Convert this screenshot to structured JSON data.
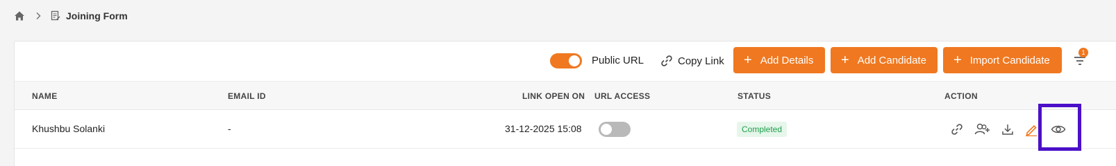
{
  "breadcrumb": {
    "home_icon": "home-icon",
    "separator_icon": "chevron-right-icon",
    "page_icon": "form-document-icon",
    "title": "Joining Form"
  },
  "toolbar": {
    "public_url_label": "Public URL",
    "public_url_enabled": true,
    "copy_link_label": "Copy Link",
    "add_details_label": "Add Details",
    "add_candidate_label": "Add Candidate",
    "import_candidate_label": "Import Candidate",
    "filter_badge_count": "1"
  },
  "table": {
    "columns": [
      "NAME",
      "EMAIL ID",
      "LINK OPEN ON",
      "URL ACCESS",
      "STATUS",
      "ACTION"
    ],
    "rows": [
      {
        "name": "Khushbu Solanki",
        "email": "-",
        "link_open_on": "31-12-2025 15:08",
        "url_access": false,
        "status": "Completed"
      }
    ]
  },
  "colors": {
    "accent": "#f07820",
    "status_success_text": "#1e9e4a",
    "status_success_bg": "#e6f6eb",
    "highlight": "#4b10c8"
  }
}
